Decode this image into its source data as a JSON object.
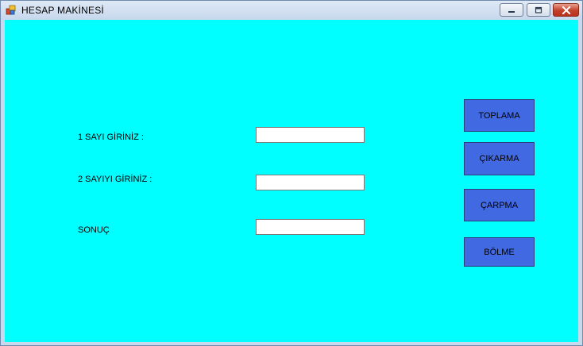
{
  "window": {
    "title": "HESAP MAKİNESİ",
    "icon": "app-window-icon",
    "controls": {
      "minimize_icon": "minimize-icon",
      "maximize_icon": "maximize-icon",
      "close_icon": "close-icon"
    }
  },
  "form": {
    "background_color": "#00ffff",
    "label_first": "1 SAYI GİRİNİZ :",
    "label_second": "2 SAYIYI GİRİNİZ :",
    "label_result": "SONUÇ",
    "input_first_value": "",
    "input_second_value": "",
    "input_result_value": ""
  },
  "buttons": {
    "color": "#4169e1",
    "add_label": "TOPLAMA",
    "subtract_label": "ÇIKARMA",
    "multiply_label": "ÇARPMA",
    "divide_label": "BÖLME"
  }
}
